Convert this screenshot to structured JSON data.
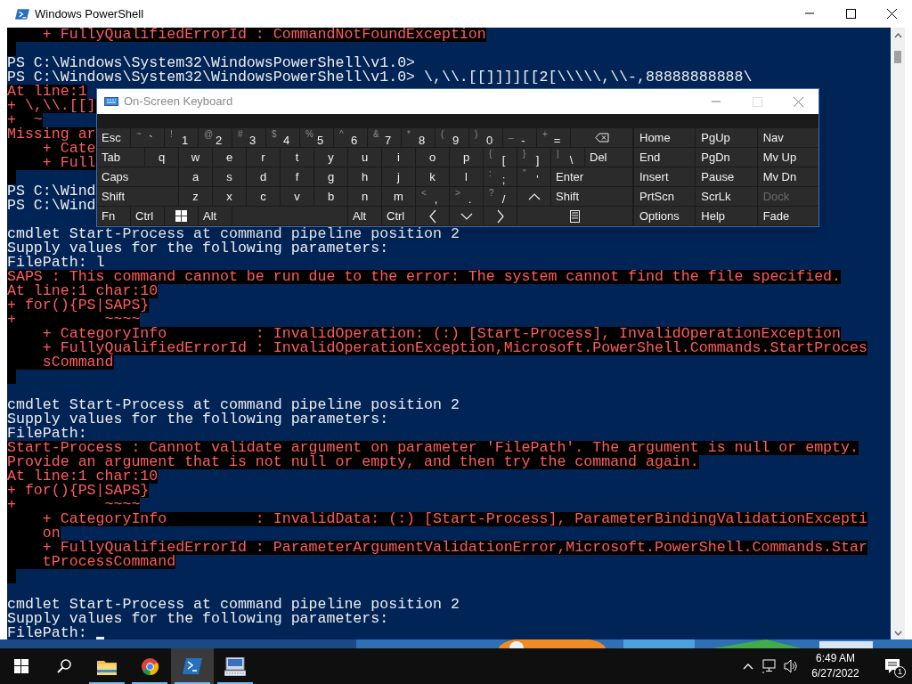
{
  "powershell_window": {
    "title": "Windows PowerShell",
    "console_lines": [
      {
        "kind": "error",
        "text": "    + FullyQualifiedErrorId : CommandNotFoundException"
      },
      {
        "kind": "error-blank"
      },
      {
        "kind": "output",
        "text": "PS C:\\Windows\\System32\\WindowsPowerShell\\v1.0>"
      },
      {
        "kind": "output",
        "text": "PS C:\\Windows\\System32\\WindowsPowerShell\\v1.0> \\,\\\\.[[]]]][[2[\\\\\\\\\\,\\\\-,88888888888\\"
      },
      {
        "kind": "error",
        "text": "At line:1"
      },
      {
        "kind": "error",
        "text": "+ \\,\\\\.[[]"
      },
      {
        "kind": "error",
        "text": "+  ~"
      },
      {
        "kind": "error",
        "text": "Missing ar"
      },
      {
        "kind": "error",
        "text": "    + Cate"
      },
      {
        "kind": "error",
        "text": "    + Full"
      },
      {
        "kind": "error-blank"
      },
      {
        "kind": "output",
        "text": "PS C:\\Wind"
      },
      {
        "kind": "output",
        "text": "PS C:\\Wind"
      },
      {
        "kind": "blank"
      },
      {
        "kind": "output",
        "text": "cmdlet Start-Process at command pipeline position 2"
      },
      {
        "kind": "output",
        "text": "Supply values for the following parameters:"
      },
      {
        "kind": "output",
        "text": "FilePath: l"
      },
      {
        "kind": "error",
        "text": "SAPS : This command cannot be run due to the error: The system cannot find the file specified."
      },
      {
        "kind": "error",
        "text": "At line:1 char:10"
      },
      {
        "kind": "error",
        "text": "+ for(){PS|SAPS}"
      },
      {
        "kind": "error",
        "text": "+          ~~~~"
      },
      {
        "kind": "error",
        "text": "    + CategoryInfo          : InvalidOperation: (:) [Start-Process], InvalidOperationException"
      },
      {
        "kind": "error",
        "text": "    + FullyQualifiedErrorId : InvalidOperationException,Microsoft.PowerShell.Commands.StartProces"
      },
      {
        "kind": "error",
        "text": "    sCommand"
      },
      {
        "kind": "error-blank"
      },
      {
        "kind": "blank"
      },
      {
        "kind": "output",
        "text": "cmdlet Start-Process at command pipeline position 2"
      },
      {
        "kind": "output",
        "text": "Supply values for the following parameters:"
      },
      {
        "kind": "output",
        "text": "FilePath:"
      },
      {
        "kind": "error",
        "text": "Start-Process : Cannot validate argument on parameter 'FilePath'. The argument is null or empty."
      },
      {
        "kind": "error",
        "text": "Provide an argument that is not null or empty, and then try the command again."
      },
      {
        "kind": "error",
        "text": "At line:1 char:10"
      },
      {
        "kind": "error",
        "text": "+ for(){PS|SAPS}"
      },
      {
        "kind": "error",
        "text": "+          ~~~~"
      },
      {
        "kind": "error",
        "text": "    + CategoryInfo          : InvalidData: (:) [Start-Process], ParameterBindingValidationExcepti"
      },
      {
        "kind": "error",
        "text": "    on"
      },
      {
        "kind": "error",
        "text": "    + FullyQualifiedErrorId : ParameterArgumentValidationError,Microsoft.PowerShell.Commands.Star"
      },
      {
        "kind": "error",
        "text": "    tProcessCommand"
      },
      {
        "kind": "error-blank"
      },
      {
        "kind": "blank"
      },
      {
        "kind": "output",
        "text": "cmdlet Start-Process at command pipeline position 2"
      },
      {
        "kind": "output",
        "text": "Supply values for the following parameters:"
      },
      {
        "kind": "output",
        "text": "FilePath:",
        "cursor": true
      }
    ]
  },
  "on_screen_keyboard": {
    "title": "On-Screen Keyboard",
    "rows": [
      {
        "keys": [
          {
            "kind": "label",
            "label": "Esc"
          },
          {
            "kind": "char",
            "shift": "~",
            "label": "`"
          },
          {
            "kind": "char",
            "shift": "!",
            "label": "1"
          },
          {
            "kind": "char",
            "shift": "@",
            "label": "2"
          },
          {
            "kind": "char",
            "shift": "#",
            "label": "3"
          },
          {
            "kind": "char",
            "shift": "$",
            "label": "4"
          },
          {
            "kind": "char",
            "shift": "%",
            "label": "5"
          },
          {
            "kind": "char",
            "shift": "^",
            "label": "6"
          },
          {
            "kind": "char",
            "shift": "&",
            "label": "7"
          },
          {
            "kind": "char",
            "shift": "*",
            "label": "8"
          },
          {
            "kind": "char",
            "shift": "(",
            "label": "9"
          },
          {
            "kind": "char",
            "shift": ")",
            "label": "0"
          },
          {
            "kind": "char",
            "shift": "_",
            "label": "-"
          },
          {
            "kind": "char",
            "shift": "+",
            "label": "="
          },
          {
            "kind": "backspace"
          }
        ]
      },
      {
        "keys": [
          {
            "kind": "wide",
            "label": "Tab"
          },
          {
            "kind": "char",
            "label": "q"
          },
          {
            "kind": "char",
            "label": "w"
          },
          {
            "kind": "char",
            "label": "e"
          },
          {
            "kind": "char",
            "label": "r"
          },
          {
            "kind": "char",
            "label": "t"
          },
          {
            "kind": "char",
            "label": "y"
          },
          {
            "kind": "char",
            "label": "u"
          },
          {
            "kind": "char",
            "label": "i"
          },
          {
            "kind": "char",
            "label": "o"
          },
          {
            "kind": "char",
            "label": "p"
          },
          {
            "kind": "char",
            "shift": "{",
            "label": "["
          },
          {
            "kind": "char",
            "shift": "}",
            "label": "]"
          },
          {
            "kind": "char",
            "shift": "|",
            "label": "\\"
          },
          {
            "kind": "wide",
            "label": "Del"
          }
        ]
      },
      {
        "keys": [
          {
            "kind": "wide",
            "label": "Caps"
          },
          {
            "kind": "char",
            "label": "a"
          },
          {
            "kind": "char",
            "label": "s"
          },
          {
            "kind": "char",
            "label": "d"
          },
          {
            "kind": "char",
            "label": "f"
          },
          {
            "kind": "char",
            "label": "g"
          },
          {
            "kind": "char",
            "label": "h"
          },
          {
            "kind": "char",
            "label": "j"
          },
          {
            "kind": "char",
            "label": "k"
          },
          {
            "kind": "char",
            "label": "l"
          },
          {
            "kind": "char",
            "shift": ":",
            "label": ";"
          },
          {
            "kind": "char",
            "shift": "\"",
            "label": "'"
          },
          {
            "kind": "wide",
            "label": "Enter"
          }
        ]
      },
      {
        "keys": [
          {
            "kind": "wide",
            "label": "Shift"
          },
          {
            "kind": "char",
            "label": "z"
          },
          {
            "kind": "char",
            "label": "x"
          },
          {
            "kind": "char",
            "label": "c"
          },
          {
            "kind": "char",
            "label": "v"
          },
          {
            "kind": "char",
            "label": "b"
          },
          {
            "kind": "char",
            "label": "n"
          },
          {
            "kind": "char",
            "label": "m"
          },
          {
            "kind": "char",
            "shift": "<",
            "label": ","
          },
          {
            "kind": "char",
            "shift": ">",
            "label": "."
          },
          {
            "kind": "char",
            "shift": "?",
            "label": "/"
          },
          {
            "kind": "up"
          },
          {
            "kind": "wide",
            "label": "Shift"
          }
        ]
      },
      {
        "keys": [
          {
            "kind": "label",
            "label": "Fn"
          },
          {
            "kind": "label",
            "label": "Ctrl"
          },
          {
            "kind": "windows"
          },
          {
            "kind": "label",
            "label": "Alt"
          },
          {
            "kind": "space"
          },
          {
            "kind": "label",
            "label": "Alt"
          },
          {
            "kind": "label",
            "label": "Ctrl"
          },
          {
            "kind": "left"
          },
          {
            "kind": "down"
          },
          {
            "kind": "right"
          },
          {
            "kind": "menu"
          }
        ]
      }
    ],
    "nav_keys": [
      {
        "label": "Home",
        "disabled": false
      },
      {
        "label": "PgUp",
        "disabled": false
      },
      {
        "label": "Nav",
        "disabled": false
      },
      {
        "label": "End",
        "disabled": false
      },
      {
        "label": "PgDn",
        "disabled": false
      },
      {
        "label": "Mv Up",
        "disabled": false
      },
      {
        "label": "Insert",
        "disabled": false
      },
      {
        "label": "Pause",
        "disabled": false
      },
      {
        "label": "Mv Dn",
        "disabled": false
      },
      {
        "label": "PrtScn",
        "disabled": false
      },
      {
        "label": "ScrLk",
        "disabled": false
      },
      {
        "label": "Dock",
        "disabled": true
      },
      {
        "label": "Options",
        "disabled": false
      },
      {
        "label": "Help",
        "disabled": false
      },
      {
        "label": "Fade",
        "disabled": false
      }
    ]
  },
  "taskbar": {
    "items": [
      {
        "kind": "start"
      },
      {
        "kind": "search"
      },
      {
        "kind": "folder",
        "open": true,
        "selected": false
      },
      {
        "kind": "browser",
        "open": true,
        "selected": false
      },
      {
        "kind": "terminal",
        "open": true,
        "selected": true
      },
      {
        "kind": "keyboard",
        "open": true,
        "selected": false
      }
    ],
    "clock": {
      "time": "6:49 AM",
      "date": "6/27/2022"
    },
    "notification_count": "1"
  }
}
